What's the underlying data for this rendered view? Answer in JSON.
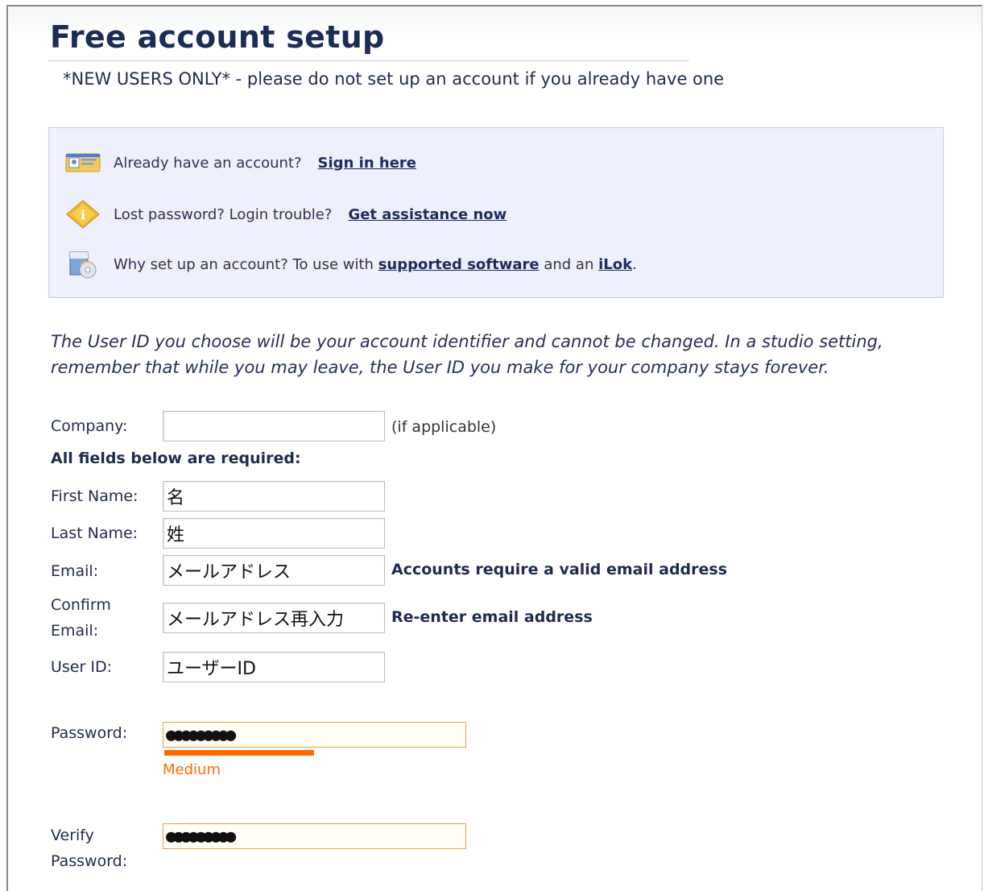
{
  "header": {
    "title": "Free account setup",
    "subtitle": "*NEW USERS ONLY* - please do not set up an account if you already have one"
  },
  "infobox": {
    "signin": {
      "text": "Already have an account?",
      "link": "Sign in here",
      "icon": "id-card-icon"
    },
    "assist": {
      "text": "Lost password? Login trouble?",
      "link": "Get assistance now",
      "icon": "info-icon"
    },
    "why": {
      "text1": "Why set up an account? To use with",
      "link1": "supported software",
      "text2": "and an",
      "link2": "iLok",
      "text3": ".",
      "icon": "software-box-icon"
    }
  },
  "intro": "The User ID you choose will be your account identifier and cannot be changed. In a studio setting, remember that while you may leave, the User ID you make for your company stays forever.",
  "form": {
    "company_label": "Company:",
    "company_value": "",
    "company_hint": "(if applicable)",
    "required_note": "All fields below are required:",
    "first_name_label": "First Name:",
    "first_name_value": "名",
    "last_name_label": "Last Name:",
    "last_name_value": "姓",
    "email_label": "Email:",
    "email_value": "メールアドレス",
    "email_hint": "Accounts require a valid email address",
    "confirm_label_1": "Confirm",
    "confirm_label_2": "Email:",
    "confirm_value": "メールアドレス再入力",
    "confirm_hint": "Re-enter email address",
    "userid_label": "User ID:",
    "userid_value": "ユーザーID",
    "password_label": "Password:",
    "password_value": "●●●●●●●●●",
    "strength_label": "Medium",
    "strength_fraction": 0.5,
    "verify_label_1": "Verify",
    "verify_label_2": "Password:",
    "verify_value": "●●●●●●●●●"
  },
  "colors": {
    "title": "#1b2c55",
    "infobox_bg": "#eef0fb",
    "strength": "#ff6a00",
    "password_border": "#d8a64a"
  }
}
